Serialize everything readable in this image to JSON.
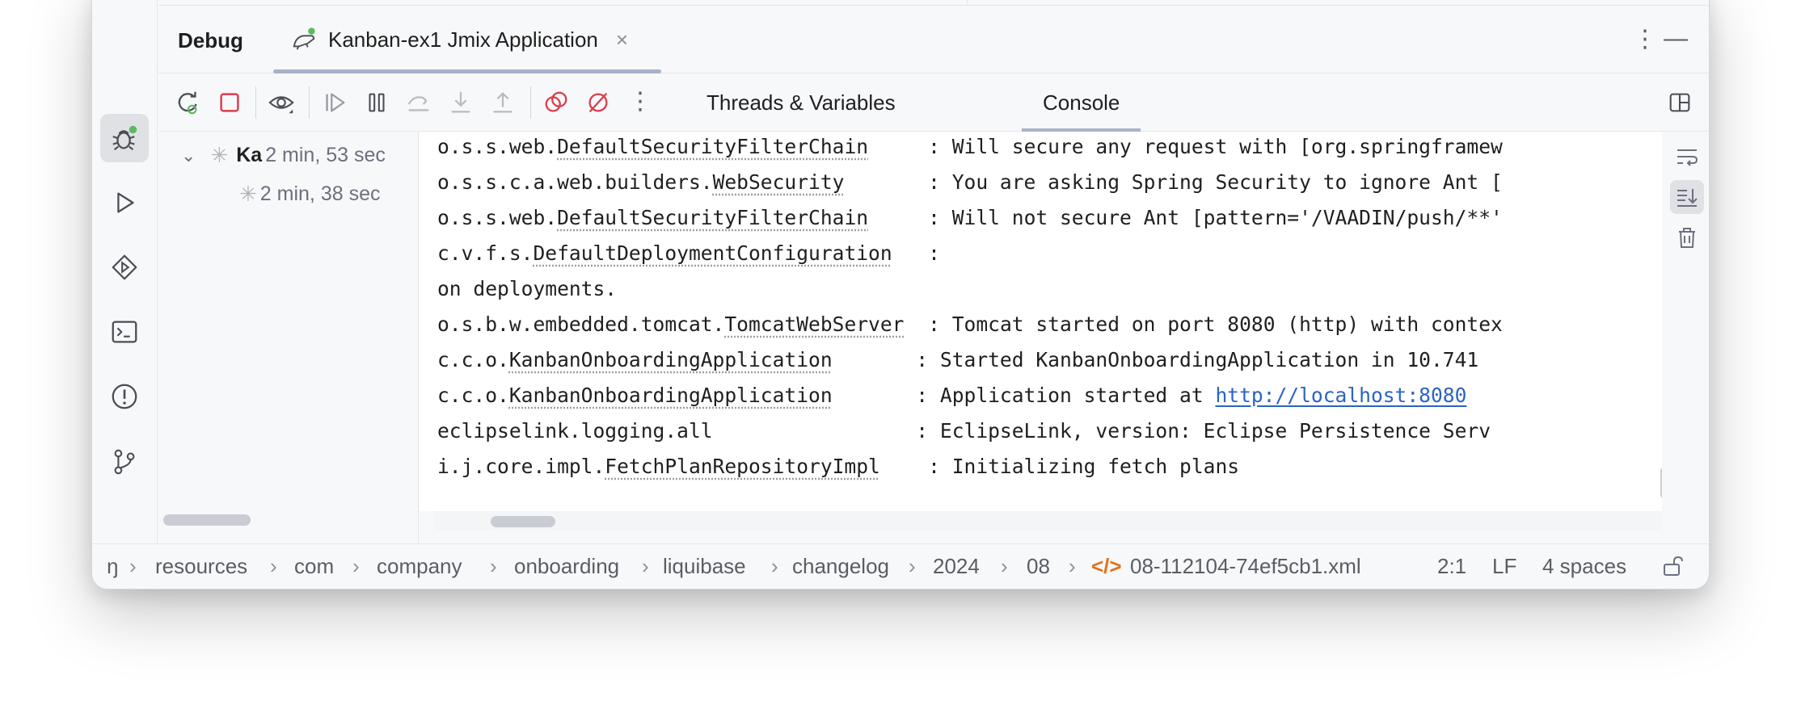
{
  "debug": {
    "title": "Debug",
    "run_tab_label": "Kanban-ex1 Jmix Application",
    "run_tab_close": "×",
    "more": "⋮",
    "minimize": "—"
  },
  "toolbar": {
    "more": "⋮",
    "tabs": [
      {
        "label": "Threads & Variables",
        "active": false
      },
      {
        "label": "Console",
        "active": true
      }
    ]
  },
  "frames": [
    {
      "name": "Ka",
      "time": "2 min, 53 sec"
    },
    {
      "name": "",
      "time": "2 min, 38 sec"
    }
  ],
  "console": {
    "lines": [
      {
        "prefix": "o.s.s.web.",
        "cls": "DefaultSecurityFilterChain",
        "pad": "     ",
        "msg": ": Will secure any request with [org.springframew"
      },
      {
        "prefix": "o.s.s.c.a.web.builders.",
        "cls": "WebSecurity",
        "pad": "       ",
        "msg": ": You are asking Spring Security to ignore Ant ["
      },
      {
        "prefix": "o.s.s.web.",
        "cls": "DefaultSecurityFilterChain",
        "pad": "     ",
        "msg": ": Will not secure Ant [pattern='/VAADIN/push/**'"
      },
      {
        "prefix": "c.v.f.s.",
        "cls": "DefaultDeploymentConfiguration",
        "pad": "   ",
        "msg": ":"
      },
      {
        "prefix": "on deployments.",
        "cls": "",
        "pad": "",
        "msg": ""
      },
      {
        "prefix": "o.s.b.w.embedded.tomcat.",
        "cls": "TomcatWebServer",
        "pad": "  ",
        "msg": ": Tomcat started on port 8080 (http) with contex"
      },
      {
        "prefix": "c.c.o.",
        "cls": "KanbanOnboardingApplication",
        "pad": "       ",
        "msg": ": Started KanbanOnboardingApplication in 10.741"
      },
      {
        "prefix": "c.c.o.",
        "cls": "KanbanOnboardingApplication",
        "pad": "       ",
        "msg": ": Application started at ",
        "link": "http://localhost:8080"
      },
      {
        "prefix": "eclipselink.logging.all",
        "cls": "",
        "pad": "                 ",
        "msg": ": EclipseLink, version: Eclipse Persistence Serv"
      },
      {
        "prefix": "i.j.core.impl.",
        "cls": "FetchPlanRepositoryImpl",
        "pad": "    ",
        "msg": ": Initializing fetch plans"
      }
    ]
  },
  "breadcrumbs": [
    "ŋ",
    "resources",
    "com",
    "company",
    "onboarding",
    "liquibase",
    "changelog",
    "2024",
    "08",
    "08-112104-74ef5cb1.xml"
  ],
  "status": {
    "position": "2:1",
    "line_sep": "LF",
    "indent": "4 spaces"
  },
  "colors": {
    "accent_green": "#5fb865",
    "stop_red": "#db3b4b",
    "link_blue": "#2b63c7",
    "xml_orange": "#e0731b"
  }
}
